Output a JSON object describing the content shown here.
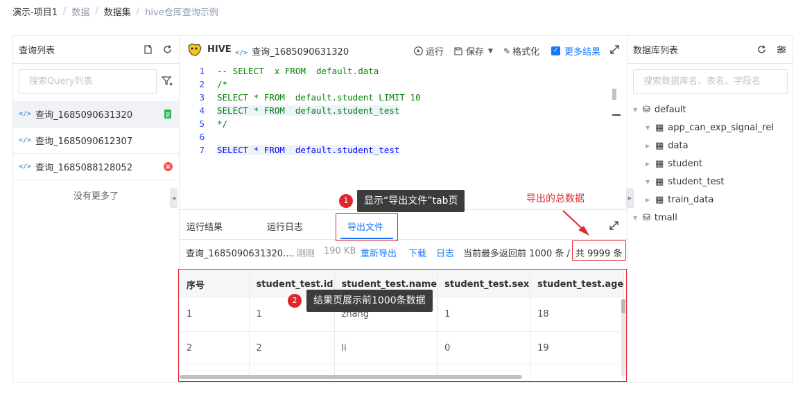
{
  "breadcrumb": [
    "演示-项目1",
    "数据",
    "数据集",
    "hive仓库查询示例"
  ],
  "left_panel": {
    "title": "查询列表",
    "search_placeholder": "搜索Query列表",
    "items": [
      {
        "tag": "</>",
        "name": "查询_1685090631320"
      },
      {
        "tag": "</>",
        "name": "查询_1685090612307"
      },
      {
        "tag": "</>",
        "name": "查询_1685088128052"
      }
    ],
    "no_more": "没有更多了"
  },
  "editor": {
    "engine": "HIVE",
    "tag": "</>",
    "file_name": "查询_1685090631320",
    "toolbar": {
      "run": "运行",
      "save": "保存",
      "format": "格式化",
      "more_results": "更多结果"
    },
    "lines": [
      {
        "num": "1",
        "text": "-- SELECT  x FROM  default.data"
      },
      {
        "num": "2",
        "text": "/*"
      },
      {
        "num": "3",
        "text": "SELECT * FROM  default.student LIMIT 10"
      },
      {
        "num": "4",
        "text": "SELECT * FROM  default.student_test"
      },
      {
        "num": "5",
        "text": "*/"
      },
      {
        "num": "6",
        "text": ""
      },
      {
        "num": "7",
        "text": "SELECT * FROM  default.student_test"
      }
    ]
  },
  "result_tabs": [
    "运行结果",
    "运行日志",
    "导出文件"
  ],
  "export_info": {
    "file": "查询_1685090631320....",
    "time": "刚刚",
    "size": "190 KB",
    "reexport": "重新导出",
    "download": "下载",
    "log": "日志",
    "limit_text": "当前最多返回前 1000 条 /",
    "total": "共 9999 条"
  },
  "table": {
    "columns": [
      "序号",
      "student_test.id",
      "student_test.name",
      "student_test.sex",
      "student_test.age"
    ],
    "rows": [
      [
        "1",
        "1",
        "zhang",
        "1",
        "18"
      ],
      [
        "2",
        "2",
        "li",
        "0",
        "19"
      ]
    ]
  },
  "right_panel": {
    "title": "数据库列表",
    "search_placeholder": "搜索数据库名、表名、字段名",
    "db1": "default",
    "tables": [
      "app_can_exp_signal_rel",
      "data",
      "student",
      "student_test",
      "train_data"
    ],
    "db2": "tmall"
  },
  "annotations": {
    "tip1_num": "1",
    "tip1": "显示“导出文件”tab页",
    "tip2_num": "2",
    "tip2": "结果页展示前1000条数据",
    "total_label": "导出的总数据"
  },
  "colors": {
    "accent": "#1677ff",
    "annotation": "#e0262b"
  }
}
